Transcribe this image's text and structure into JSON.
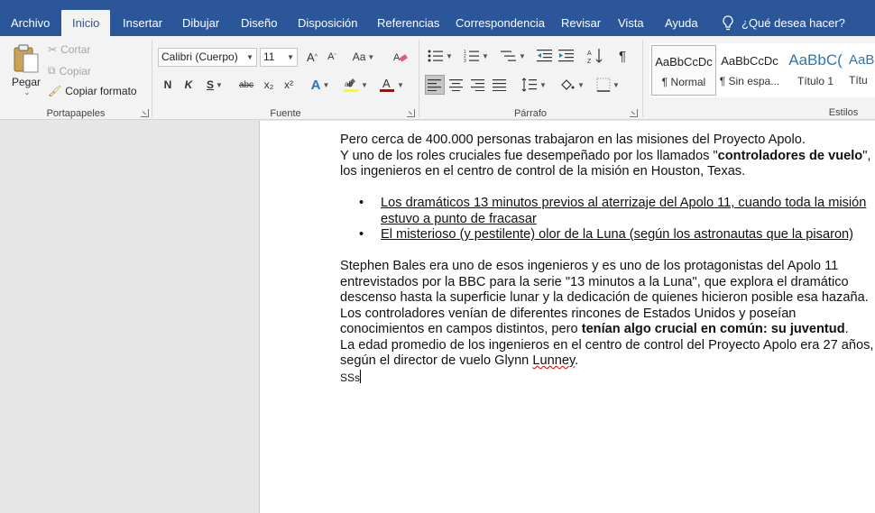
{
  "tabs": [
    "Archivo",
    "Inicio",
    "Insertar",
    "Dibujar",
    "Diseño",
    "Disposición",
    "Referencias",
    "Correspondencia",
    "Revisar",
    "Vista",
    "Ayuda"
  ],
  "tell_me": "¿Qué desea hacer?",
  "clipboard": {
    "paste": "Pegar",
    "cut": "Cortar",
    "copy": "Copiar",
    "format_painter": "Copiar formato",
    "label": "Portapapeles"
  },
  "font": {
    "name": "Calibri (Cuerpo)",
    "size": "11",
    "label": "Fuente",
    "bold": "N",
    "italic": "K",
    "underline": "S",
    "strike": "abc",
    "sub": "x₂",
    "sup": "x²",
    "change_case": "Aa"
  },
  "paragraph": {
    "label": "Párrafo",
    "pilcrow": "¶"
  },
  "styles": {
    "label": "Estilos",
    "items": [
      {
        "sample": "AaBbCcDc",
        "name": "¶ Normal"
      },
      {
        "sample": "AaBbCcDc",
        "name": "¶ Sin espa..."
      },
      {
        "sample": "AaBbC(",
        "name": "Título 1"
      },
      {
        "sample": "AaBb",
        "name": "Títu"
      }
    ]
  },
  "document": {
    "p1": "Pero cerca de 400.000 personas trabajaron en las misiones del Proyecto Apolo.",
    "p2_a": "Y uno de los roles cruciales fue desempeñado por los llamados \"",
    "p2_bold": "controladores de vuelo",
    "p2_b": "\", los ingenieros en el centro de control de la misión en Houston, Texas.",
    "bullets": [
      "Los dramáticos 13 minutos previos al aterrizaje del Apolo 11, cuando toda la misión estuvo a punto de fracasar",
      "El misterioso (y pestilente) olor de la Luna (según los astronautas que la pisaron)"
    ],
    "p3": "Stephen Bales era uno de esos ingenieros y es uno de los protagonistas del Apolo 11 entrevistados por la BBC para la serie \"13 minutos a la Luna\", que explora el dramático descenso hasta la superficie lunar y la dedicación de quienes hicieron posible esa hazaña.",
    "p4_a": "Los controladores venían de diferentes rincones de Estados Unidos y poseían conocimientos en campos distintos, pero ",
    "p4_bold": "tenían algo crucial en común: su juventud",
    "p4_b": ".",
    "p5_a": "La edad promedio de los ingenieros en el centro de control del Proyecto Apolo era 27 años, según el director de vuelo Glynn ",
    "p5_squig": "Lunney",
    "p5_b": ".",
    "p6": "SSs"
  },
  "colors": {
    "accent": "#2b579a",
    "ribbon": "#f3f3f3",
    "highlight": "#ffff00",
    "font_color": "#c00000"
  }
}
